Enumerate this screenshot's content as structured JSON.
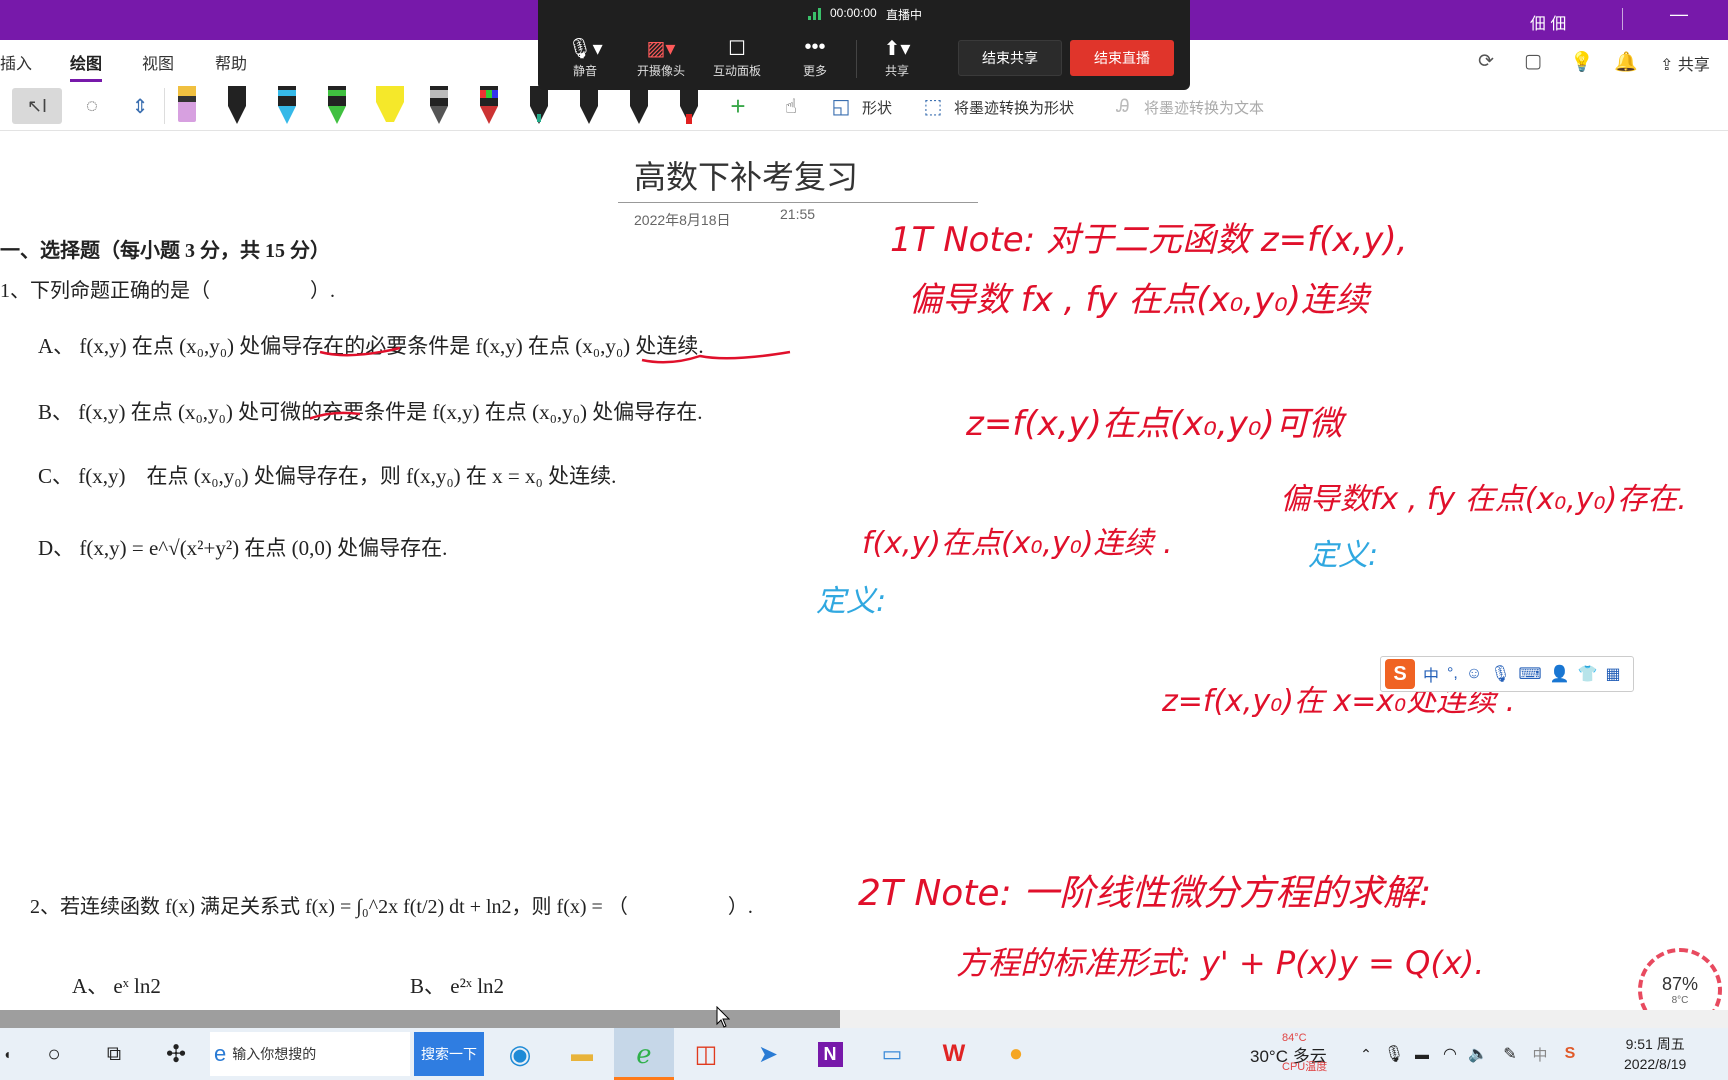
{
  "window": {
    "user_name": "佃 佃"
  },
  "menu": {
    "tabs": [
      {
        "label": "插入"
      },
      {
        "label": "绘图"
      },
      {
        "label": "视图"
      },
      {
        "label": "帮助"
      }
    ],
    "share_label": "共享"
  },
  "toolbar": {
    "shapes_label": "形状",
    "ink_to_shape_label": "将墨迹转换为形状",
    "ink_to_text_label": "将墨迹转换为文本"
  },
  "meeting": {
    "timer": "00:00:00",
    "status": "直播中",
    "buttons": [
      {
        "label": "静音",
        "icon": "mic-icon"
      },
      {
        "label": "开摄像头",
        "icon": "camera-off-icon"
      },
      {
        "label": "互动面板",
        "icon": "chat-icon"
      },
      {
        "label": "更多",
        "icon": "more-icon"
      },
      {
        "label": "共享",
        "icon": "share-screen-icon"
      }
    ],
    "end_share_label": "结束共享",
    "end_live_label": "结束直播"
  },
  "page": {
    "title": "高数下补考复习",
    "date": "2022年8月18日",
    "time": "21:55",
    "section_heading": "一、选择题（每小题 3 分，共 15 分）",
    "q1_stem": "1、下列命题正确的是（　　　　　）.",
    "q1_options": {
      "A": "A、 f(x,y) 在点 (x₀,y₀) 处偏导存在的必要条件是 f(x,y) 在点 (x₀,y₀) 处连续.",
      "B": "B、 f(x,y) 在点 (x₀,y₀) 处可微的充要条件是 f(x,y) 在点 (x₀,y₀) 处偏导存在.",
      "C": "C、 f(x,y)　在点 (x₀,y₀) 处偏导存在，则 f(x,y₀) 在 x = x₀ 处连续.",
      "D": "D、 f(x,y) = e^√(x²+y²) 在点 (0,0) 处偏导存在."
    },
    "q2_stem": "2、若连续函数 f(x) 满足关系式 f(x) = ∫₀^2x f(t/2) dt + ln2，则 f(x) = （　　　　　）.",
    "q2_options": {
      "A": "A、 eˣ ln2",
      "B": "B、 e²ˣ ln2"
    }
  },
  "ink_notes": {
    "note1_line1": "1T Note: 对于二元函数 z=f(x,y),",
    "note1_line2": "偏导数 fx , fy 在点(x₀,y₀)连续",
    "note1_line3": "z=f(x,y)在点(x₀,y₀)可微",
    "note1_line4": "偏导数fx , fy 在点(x₀,y₀)存在.",
    "note1_line5": "f(x,y)在点(x₀,y₀)连续 .",
    "definition_1": "定义:",
    "definition_2": "定义:",
    "note1_line6": "z=f(x,y₀)在 x=x₀处连续 .",
    "note2_line1": "2T  Note: 一阶线性微分方程的求解:",
    "note2_line2": "方程的标准形式:  y' + P(x)y = Q(x)."
  },
  "ime_bar": {
    "mode": "中"
  },
  "zoom": {
    "percent": "87%",
    "sub": "8°C"
  },
  "taskbar": {
    "search_placeholder": "输入你想搜的",
    "search_button": "搜索一下",
    "weather": "30°C 多云",
    "weather_sub": "84°C",
    "cpu_label": "CPU温度",
    "tray_lang": "中",
    "time": "9:51 周五",
    "date": "2022/8/19"
  }
}
